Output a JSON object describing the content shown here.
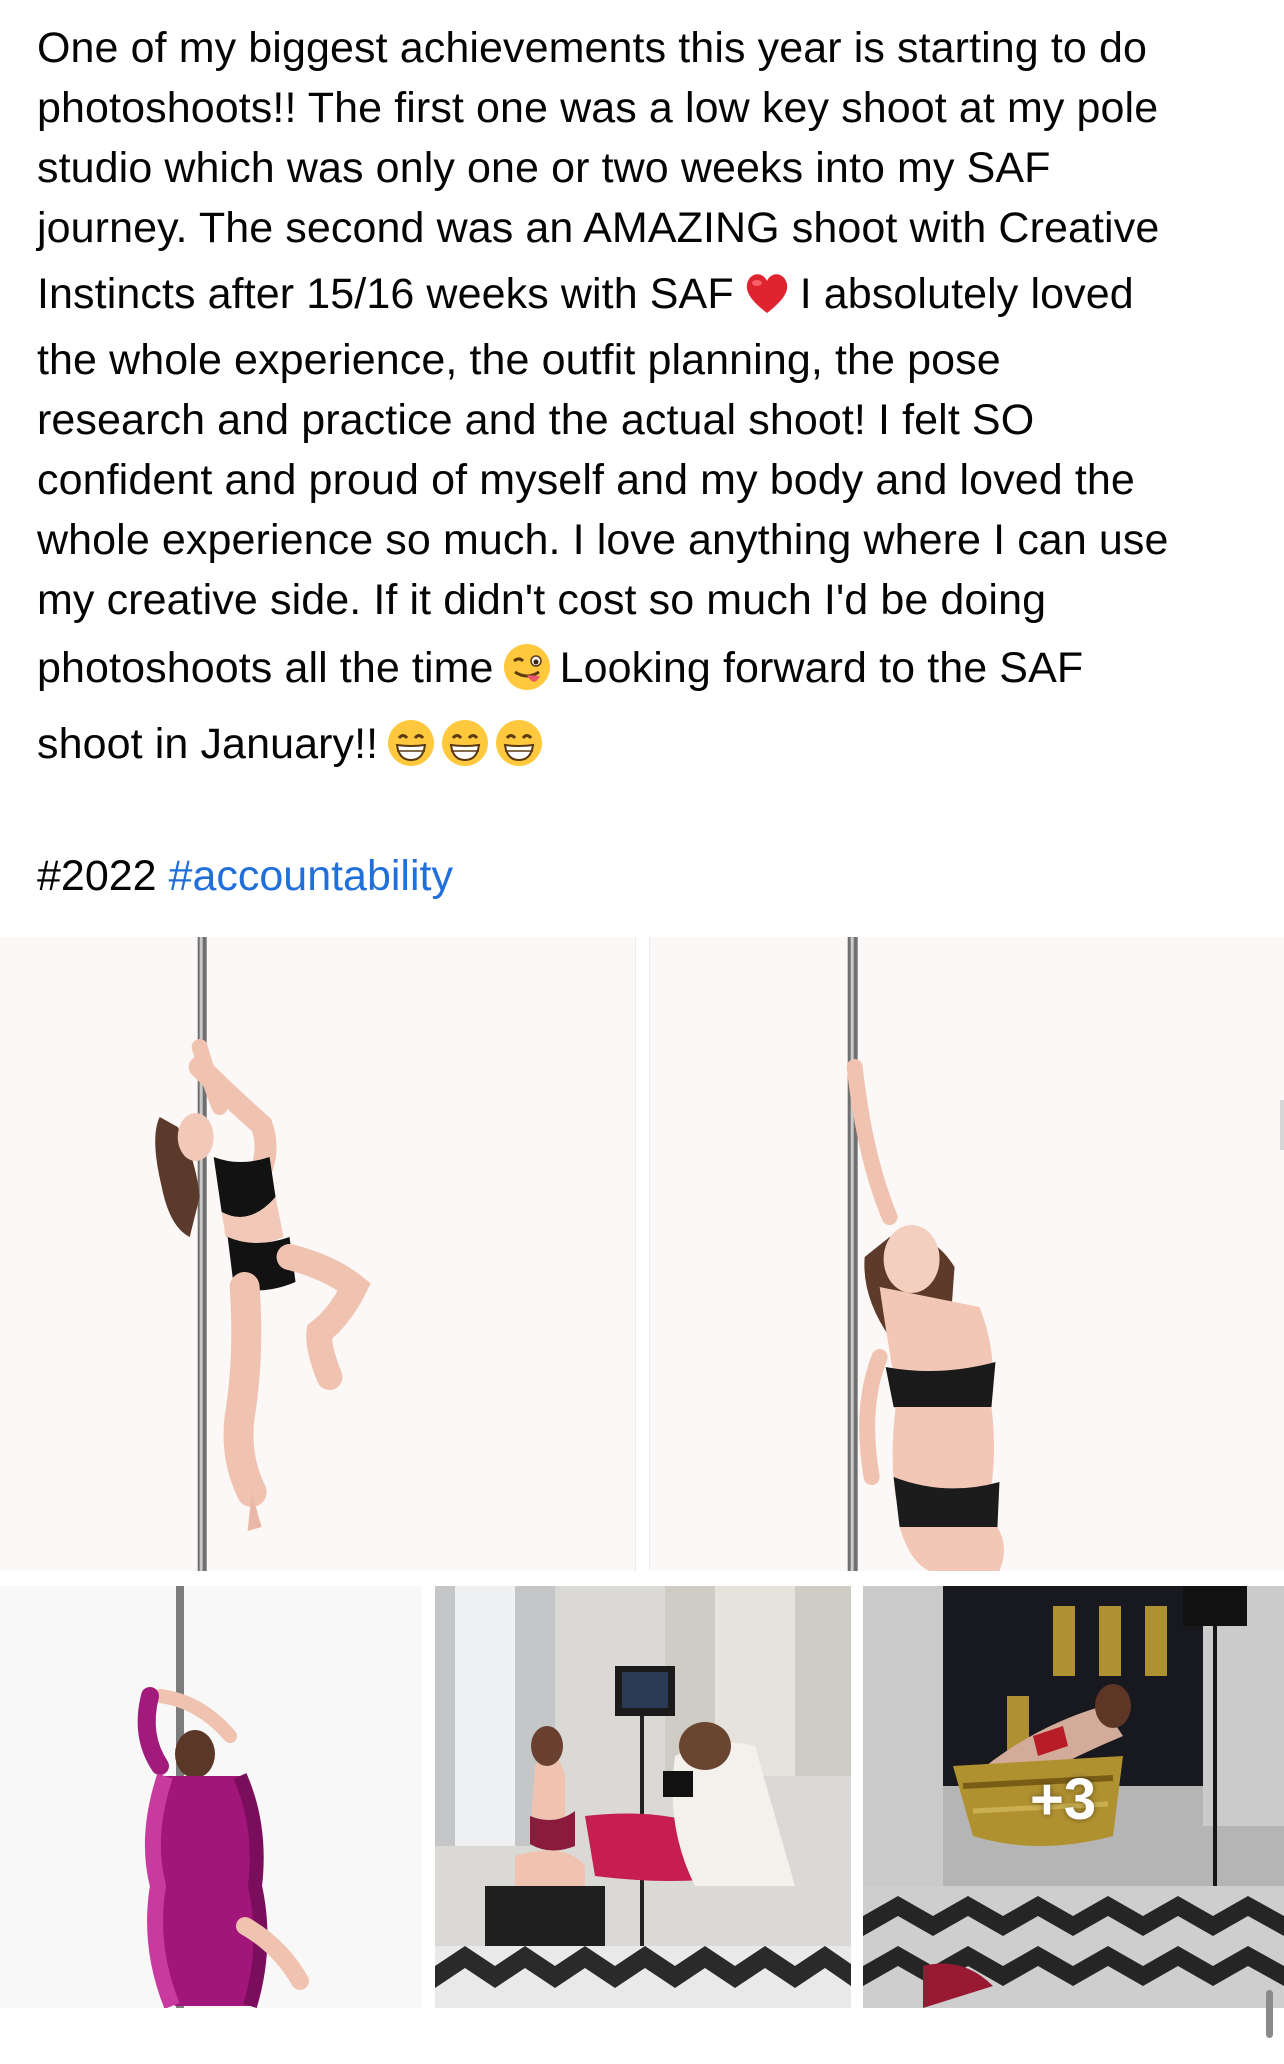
{
  "post": {
    "text_lines": [
      "One of my biggest achievements this year is starting to do",
      "photoshoots!! The first one was a low key shoot at my pole",
      "studio which was only one or two weeks into my SAF",
      "journey. The second was an AMAZING shoot with Creative",
      "Instincts after 15/16 weeks with SAF",
      "I absolutely loved",
      "the whole experience, the outfit planning, the pose",
      "research and practice and the actual shoot! I felt SO",
      "confident and proud of myself and my body and loved the",
      "whole experience so much. I love anything where I can use",
      "my creative side. If it didn't cost so much I'd be doing",
      "photoshoots all the time",
      "Looking forward to the SAF",
      "shoot in January!!"
    ],
    "emojis": {
      "heart": "red-heart-emoji",
      "wink_tongue": "winking-face-with-tongue-emoji",
      "grin": "grinning-face-emoji"
    },
    "hashtags": {
      "plain": "#2022",
      "link": "#accountability"
    },
    "more_photos_label": "+3",
    "colors": {
      "link": "#216fdb",
      "text": "#050505",
      "heart": "#e0242f",
      "emoji_yellow": "#ffc83d"
    }
  }
}
